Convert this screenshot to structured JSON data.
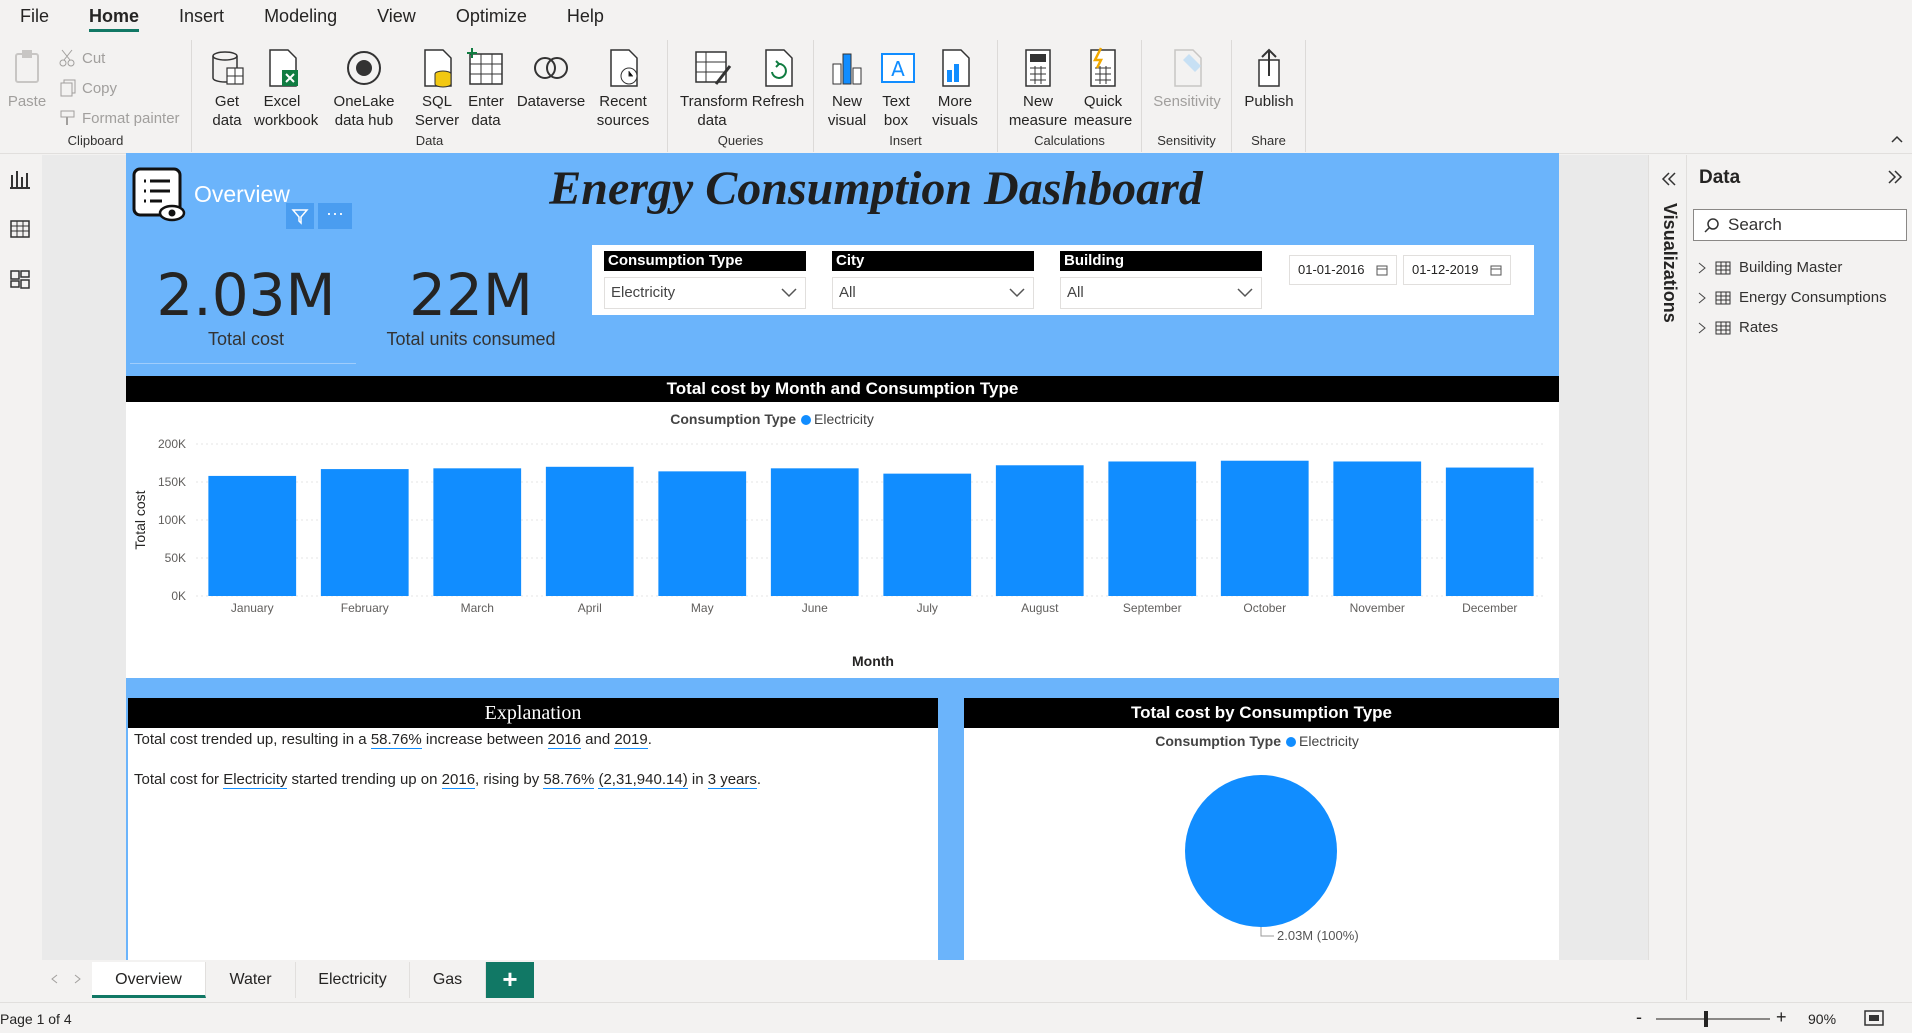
{
  "menu": [
    "File",
    "Home",
    "Insert",
    "Modeling",
    "View",
    "Optimize",
    "Help"
  ],
  "ribbon": {
    "clipboard": {
      "label": "Clipboard",
      "paste": "Paste",
      "cut": "Cut",
      "copy": "Copy",
      "format_painter": "Format painter"
    },
    "data": {
      "label": "Data",
      "get_data": "Get data",
      "excel": "Excel workbook",
      "onelake": "OneLake data hub",
      "sql": "SQL Server",
      "enter": "Enter data",
      "dataverse": "Dataverse",
      "recent": "Recent sources"
    },
    "queries": {
      "label": "Queries",
      "transform": "Transform data",
      "refresh": "Refresh"
    },
    "insert": {
      "label": "Insert",
      "new_visual": "New visual",
      "text_box": "Text box",
      "more_visuals": "More visuals"
    },
    "calculations": {
      "label": "Calculations",
      "new_measure": "New measure",
      "quick_measure": "Quick measure"
    },
    "sensitivity": {
      "label": "Sensitivity",
      "btn": "Sensitivity"
    },
    "share": {
      "label": "Share",
      "publish": "Publish"
    }
  },
  "report": {
    "title": "Energy Consumption Dashboard",
    "overview_label": "Overview",
    "more_dots": "···",
    "cards": [
      {
        "value": "2.03M",
        "label": "Total cost"
      },
      {
        "value": "22M",
        "label": "Total units consumed"
      }
    ],
    "slicers": [
      {
        "title": "Consumption Type",
        "value": "Electricity"
      },
      {
        "title": "City",
        "value": "All"
      },
      {
        "title": "Building",
        "value": "All"
      }
    ],
    "date_from": "01-01-2016",
    "date_to": "01-12-2019"
  },
  "bar_chart": {
    "title": "Total cost by Month and Consumption Type",
    "legend_title": "Consumption Type",
    "legend_item": "Electricity",
    "ylabel": "Total cost",
    "xlabel": "Month",
    "yticks": [
      "0K",
      "50K",
      "100K",
      "150K",
      "200K"
    ]
  },
  "chart_data": [
    {
      "type": "bar",
      "title": "Total cost by Month and Consumption Type",
      "xlabel": "Month",
      "ylabel": "Total cost",
      "ylim": [
        0,
        200000
      ],
      "grid": true,
      "legend": "top-center",
      "categories": [
        "January",
        "February",
        "March",
        "April",
        "May",
        "June",
        "July",
        "August",
        "September",
        "October",
        "November",
        "December"
      ],
      "series": [
        {
          "name": "Electricity",
          "color": "#118dff",
          "values": [
            158000,
            167000,
            168000,
            170000,
            164000,
            168000,
            161000,
            172000,
            177000,
            178000,
            177000,
            169000
          ]
        }
      ]
    },
    {
      "type": "pie",
      "title": "Total cost by Consumption Type",
      "legend": "top-center",
      "categories": [
        "Electricity"
      ],
      "values": [
        2030000
      ],
      "colors": [
        "#118dff"
      ]
    }
  ],
  "explanation": {
    "title": "Explanation",
    "line1": {
      "a": "Total cost trended up, resulting in a ",
      "pct": "58.76%",
      "b": " increase between ",
      "y1": "2016",
      "c": " and ",
      "y2": "2019",
      "d": "."
    },
    "line2": {
      "a": "Total cost for ",
      "type": "Electricity",
      "b": " started trending up on ",
      "year": "2016",
      "c": ", rising by ",
      "pct": "58.76%",
      "d": " ",
      "amt": "(2,31,940.14)",
      "e": " in ",
      "years": "3 years",
      "f": "."
    }
  },
  "pie": {
    "title": "Total cost by Consumption Type",
    "legend_title": "Consumption Type",
    "legend_item": "Electricity",
    "label": "2.03M (100%)"
  },
  "side": {
    "visualizations": "Visualizations",
    "data_title": "Data",
    "search_placeholder": "Search",
    "tables": [
      "Building Master",
      "Energy Consumptions",
      "Rates"
    ]
  },
  "tabs": [
    "Overview",
    "Water",
    "Electricity",
    "Gas"
  ],
  "add_tab": "+",
  "status": {
    "page": "Page 1 of 4",
    "zoom": "90%",
    "minus": "-",
    "plus": "+"
  }
}
